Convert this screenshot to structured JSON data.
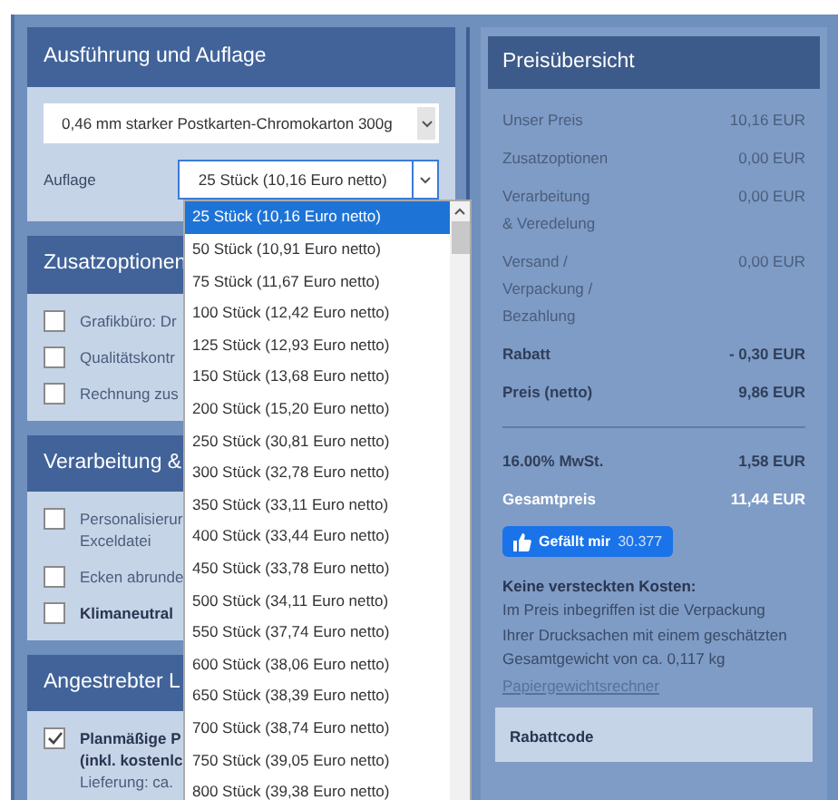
{
  "execution_panel": {
    "title": "Ausführung und Auflage",
    "material_select": {
      "value": "0,46 mm starker Postkarten-Chromokarton 300g"
    },
    "quantity_label": "Auflage",
    "quantity_select": {
      "value": "25 Stück (10,16 Euro netto)",
      "expanded": true,
      "options": [
        {
          "label": "25 Stück (10,16 Euro netto)",
          "selected": true
        },
        {
          "label": "50 Stück (10,91 Euro netto)",
          "selected": false
        },
        {
          "label": "75 Stück (11,67 Euro netto)",
          "selected": false
        },
        {
          "label": "100 Stück (12,42 Euro netto)",
          "selected": false
        },
        {
          "label": "125 Stück (12,93 Euro netto)",
          "selected": false
        },
        {
          "label": "150 Stück (13,68 Euro netto)",
          "selected": false
        },
        {
          "label": "200 Stück (15,20 Euro netto)",
          "selected": false
        },
        {
          "label": "250 Stück (30,81 Euro netto)",
          "selected": false
        },
        {
          "label": "300 Stück (32,78 Euro netto)",
          "selected": false
        },
        {
          "label": "350 Stück (33,11 Euro netto)",
          "selected": false
        },
        {
          "label": "400 Stück (33,44 Euro netto)",
          "selected": false
        },
        {
          "label": "450 Stück (33,78 Euro netto)",
          "selected": false
        },
        {
          "label": "500 Stück (34,11 Euro netto)",
          "selected": false
        },
        {
          "label": "550 Stück (37,74 Euro netto)",
          "selected": false
        },
        {
          "label": "600 Stück (38,06 Euro netto)",
          "selected": false
        },
        {
          "label": "650 Stück (38,39 Euro netto)",
          "selected": false
        },
        {
          "label": "700 Stück (38,74 Euro netto)",
          "selected": false
        },
        {
          "label": "750 Stück (39,05 Euro netto)",
          "selected": false
        },
        {
          "label": "800 Stück (39,38 Euro netto)",
          "selected": false
        }
      ]
    }
  },
  "option_panels": [
    {
      "title": "Zusatzoptionen",
      "items": [
        {
          "lines": [
            "Grafikbüro: Dr"
          ],
          "checked": false,
          "bold": false
        },
        {
          "lines": [
            "Qualitätskontr"
          ],
          "checked": false,
          "bold": false
        },
        {
          "lines": [
            "Rechnung zus"
          ],
          "checked": false,
          "bold": false
        }
      ]
    },
    {
      "title": "Verarbeitung &",
      "items": [
        {
          "lines": [
            "Personalisierur",
            "Exceldatei"
          ],
          "checked": false,
          "bold": false
        },
        {
          "lines": [
            "Ecken abrunde"
          ],
          "checked": false,
          "bold": false
        },
        {
          "lines": [
            "Klimaneutral"
          ],
          "checked": false,
          "bold": true
        }
      ]
    },
    {
      "title": "Angestrebter L",
      "items": [
        {
          "lines": [
            "Planmäßige P",
            "(inkl. kostenlc"
          ],
          "checked": true,
          "bold": true,
          "note": "Lieferung: ca."
        }
      ]
    }
  ],
  "price_panel": {
    "title": "Preisübersicht",
    "rows": [
      {
        "label": [
          "Unser Preis"
        ],
        "value": "10,16 EUR",
        "kind": "normal"
      },
      {
        "label": [
          "Zusatzoptionen"
        ],
        "value": "0,00 EUR",
        "kind": "normal"
      },
      {
        "label": [
          "Verarbeitung",
          "& Veredelung"
        ],
        "value": "0,00 EUR",
        "kind": "normal"
      },
      {
        "label": [
          "Versand /",
          "Verpackung /",
          "Bezahlung"
        ],
        "value": "0,00 EUR",
        "kind": "normal"
      },
      {
        "label": [
          "Rabatt"
        ],
        "value": "- 0,30 EUR",
        "kind": "bold"
      },
      {
        "label": [
          "Preis (netto)"
        ],
        "value": "9,86 EUR",
        "kind": "bold"
      },
      {
        "label": [
          "16.00% MwSt."
        ],
        "value": "1,58 EUR",
        "kind": "tax"
      },
      {
        "label": [
          "Gesamtpreis"
        ],
        "value": "11,44 EUR",
        "kind": "total"
      }
    ],
    "like_button": {
      "label": "Gefällt mir",
      "count": "30.377"
    },
    "info_title": "Keine versteckten Kosten:",
    "info_text": "Im Preis inbegriffen ist die Verpackung Ihrer Drucksachen mit einem geschätzten Gesamtgewicht von ca. 0,117 kg",
    "info_link": "Papiergewichtsrechner",
    "discount_title": "Rabattcode"
  }
}
